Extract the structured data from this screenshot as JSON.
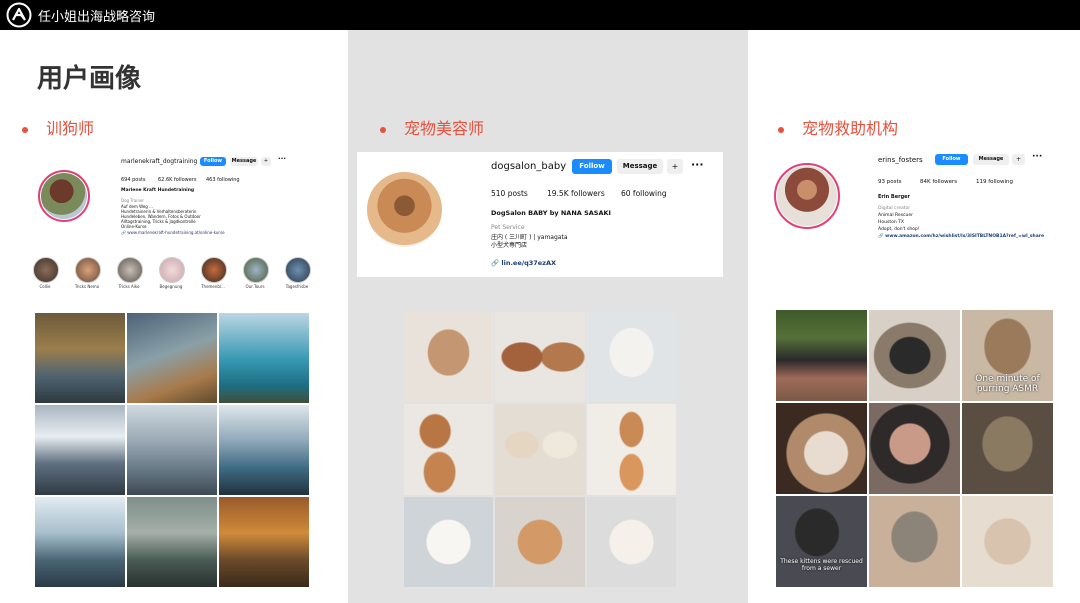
{
  "brand": "任小姐出海战略咨询",
  "page_title": "用户画像",
  "sections": [
    "训狗师",
    "宠物美容师",
    "宠物救助机构"
  ],
  "p1": {
    "username": "marlenekraft_dogtraining",
    "follow": "Follow",
    "message": "Message",
    "stats": [
      "694 posts",
      "62.6K followers",
      "463 following"
    ],
    "name": "Marlene Kraft Hundetraining",
    "category": "Dog Trainer",
    "bio": [
      "Auf dem Weg ...",
      "Hundetrainerin & Verhaltensberaterin",
      "Hundeleben, Wandern, Fotos & Outdoor",
      "Alltagstraining, Tricks & Jagdkontrolle",
      "Online-Kurse"
    ],
    "link": "www.marlenekraft-hundetraining.at/online-kurse",
    "highlights": [
      "Collie",
      "Tricks Nemo",
      "Tricks Aiko",
      "Begegnung",
      "Themenbl...",
      "Our Tours",
      "Tagesfrisbe"
    ]
  },
  "p2": {
    "username": "dogsalon_baby",
    "follow": "Follow",
    "message": "Message",
    "stats": [
      "510 posts",
      "19.5K followers",
      "60 following"
    ],
    "name": "DogSalon BABY by NANA SASAKI",
    "category": "Pet Service",
    "bio": [
      "庄内 ( 三川町 ) | yamagata",
      "小型犬専門店"
    ],
    "link": "lin.ee/q37ezAX"
  },
  "p3": {
    "username": "erins_fosters",
    "follow": "Follow",
    "message": "Message",
    "stats": [
      "93 posts",
      "84K followers",
      "119 following"
    ],
    "name": "Erin Berger",
    "category": "Digital creator",
    "bio": [
      "Animal Rescuer",
      "Houston TX",
      "Adopt, don't shop!"
    ],
    "link": "www.amazon.com/hz/wishlist/ls/3ISITBLTNOB1A?ref_=wl_share",
    "captions": [
      "One minute of purring ASMR",
      "These kittens were rescued from a sewer"
    ]
  },
  "icons": {
    "logo": "brand-logo-icon",
    "more": "more-icon",
    "add_user": "add-user-icon",
    "link": "link-icon"
  },
  "colors": {
    "accent": "#e5523f",
    "follow_blue": "#1a8cff",
    "panel_gray": "#e2e2e2"
  }
}
